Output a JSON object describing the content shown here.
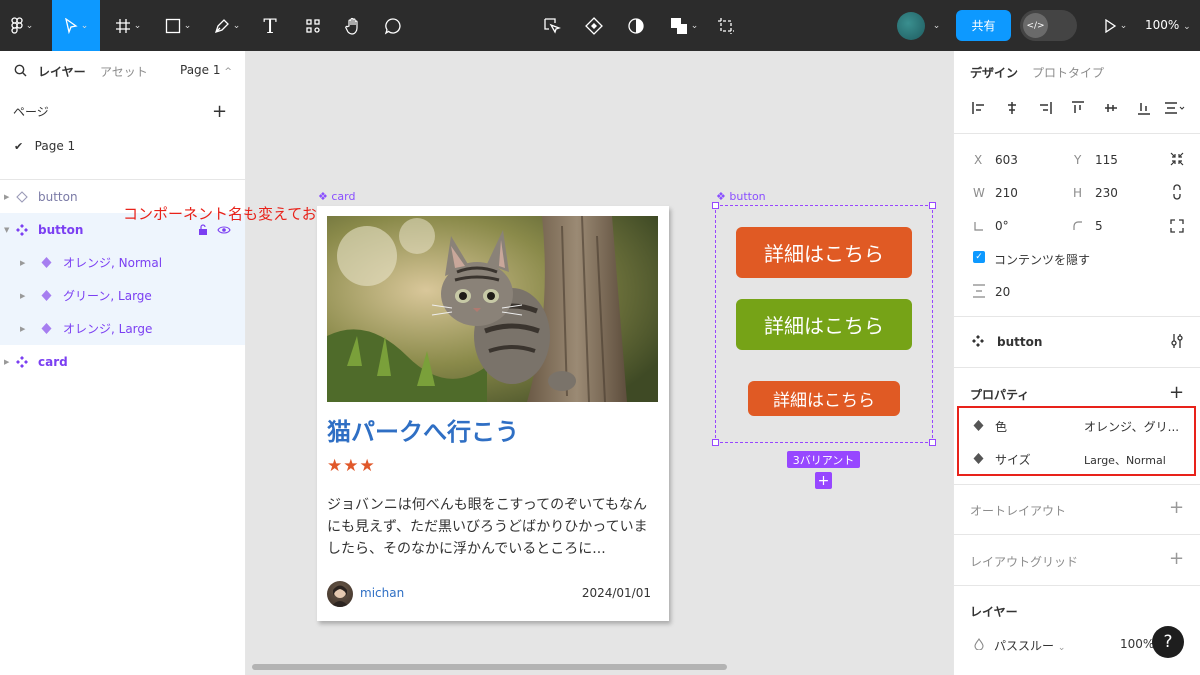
{
  "toolbar": {
    "zoom": "100%",
    "share_label": "共有",
    "text_tool": "T",
    "devmode_label": "</>"
  },
  "left_panel": {
    "search_tab": "レイヤー",
    "assets_tab": "アセット",
    "page_selector": "Page 1",
    "pages_heading": "ページ",
    "page_item": "Page 1",
    "layers": [
      {
        "label": "button"
      },
      {
        "label": "button"
      },
      {
        "label": "オレンジ, Normal"
      },
      {
        "label": "グリーン, Large"
      },
      {
        "label": "オレンジ, Large"
      },
      {
        "label": "card"
      }
    ]
  },
  "canvas": {
    "annotation": "コンポーネント名も変えておく",
    "card_frame_label": "card",
    "button_frame_label": "button",
    "card": {
      "title": "猫パークへ行こう",
      "stars": "★★★",
      "description": "ジョバンニは何べんも眼をこすってのぞいてもなんにも見えず、ただ黒いびろうどばかりひかっていましたら、そのなかに浮かんでいるところに...",
      "author": "michan",
      "date": "2024/01/01"
    },
    "buttons": [
      {
        "label": "詳細はこちら",
        "color": "#e05a24"
      },
      {
        "label": "詳細はこちら",
        "color": "#76a317"
      },
      {
        "label": "詳細はこちら",
        "color": "#e05a24"
      }
    ],
    "variant_tag": "3バリアント",
    "variant_add": "+"
  },
  "right_panel": {
    "design_tab": "デザイン",
    "prototype_tab": "プロトタイプ",
    "x_label": "X",
    "x_value": "603",
    "y_label": "Y",
    "y_value": "115",
    "w_label": "W",
    "w_value": "210",
    "h_label": "H",
    "h_value": "230",
    "rotation_value": "0°",
    "radius_value": "5",
    "clip_label": "コンテンツを隠す",
    "gap_value": "20",
    "component_name": "button",
    "properties_heading": "プロパティ",
    "props": [
      {
        "name": "色",
        "value": "オレンジ、グリ..."
      },
      {
        "name": "サイズ",
        "value": "Large、Normal"
      }
    ],
    "auto_layout": "オートレイアウト",
    "layout_grid": "レイアウトグリッド",
    "layer_heading": "レイヤー",
    "blend_mode": "パススルー",
    "opacity": "100%",
    "help": "?"
  },
  "colors": {
    "accent": "#0d99ff",
    "component_purple": "#9747ff",
    "annotation_red": "#e8221a"
  }
}
